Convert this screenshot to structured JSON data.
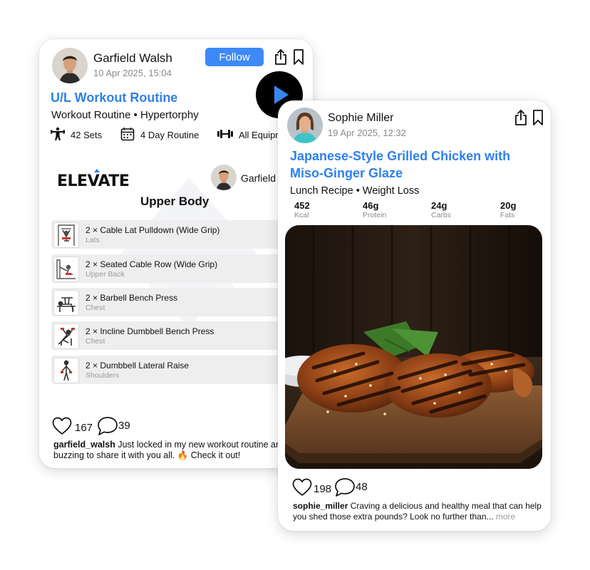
{
  "post1": {
    "author": "Garfield Walsh",
    "date": "10 Apr 2025, 15:04",
    "follow_label": "Follow",
    "title": "U/L Workout Routine",
    "subtitle": "Workout Routine • Hypertorphy",
    "stats": {
      "sets": "42 Sets",
      "routine": "4 Day Routine",
      "equipment": "All Equipm"
    },
    "preview": {
      "brand": "ELEVATE",
      "author_short": "Garfield",
      "heading": "Upper Body",
      "exercises": [
        {
          "title": "2 × Cable Lat Pulldown (Wide Grip)",
          "muscle": "Lats"
        },
        {
          "title": "2 × Seated Cable Row (Wide Grip)",
          "muscle": "Upper Back"
        },
        {
          "title": "2 × Barbell Bench Press",
          "muscle": "Chest"
        },
        {
          "title": "2 × Incline Dumbbell Bench Press",
          "muscle": "Chest"
        },
        {
          "title": "2 × Dumbbell Lateral Raise",
          "muscle": "Shoulders"
        }
      ]
    },
    "likes": "167",
    "comments": "39",
    "caption_user": "garfield_walsh",
    "caption_text": " Just locked in my new workout routine an buzzing to share it with you all. 🔥 Check it out!"
  },
  "post2": {
    "author": "Sophie Miller",
    "date": "19 Apr 2025, 12:32",
    "title_line1": "Japanese-Style Grilled Chicken with",
    "title_line2": "Miso-Ginger Glaze",
    "subtitle": "Lunch Recipe • Weight Loss",
    "macros": [
      {
        "value": "452",
        "label": "Kcal"
      },
      {
        "value": "46g",
        "label": "Protein"
      },
      {
        "value": "24g",
        "label": "Carbs"
      },
      {
        "value": "20g",
        "label": "Fats"
      }
    ],
    "likes": "198",
    "comments": "48",
    "caption_user": "sophie_miller",
    "caption_text": " Craving a delicious and healthy meal that can help you shed those extra pounds? Look no further than...",
    "more_label": " more"
  },
  "colors": {
    "accent": "#2f80ed",
    "follow_bg": "#3d8af7",
    "muted": "#8a8a8a"
  },
  "icons": [
    "share-icon",
    "bookmark-icon",
    "play-icon",
    "dumbbell-person-icon",
    "calendar-icon",
    "barbell-icon",
    "heart-icon",
    "comment-icon",
    "elevate-logo"
  ]
}
